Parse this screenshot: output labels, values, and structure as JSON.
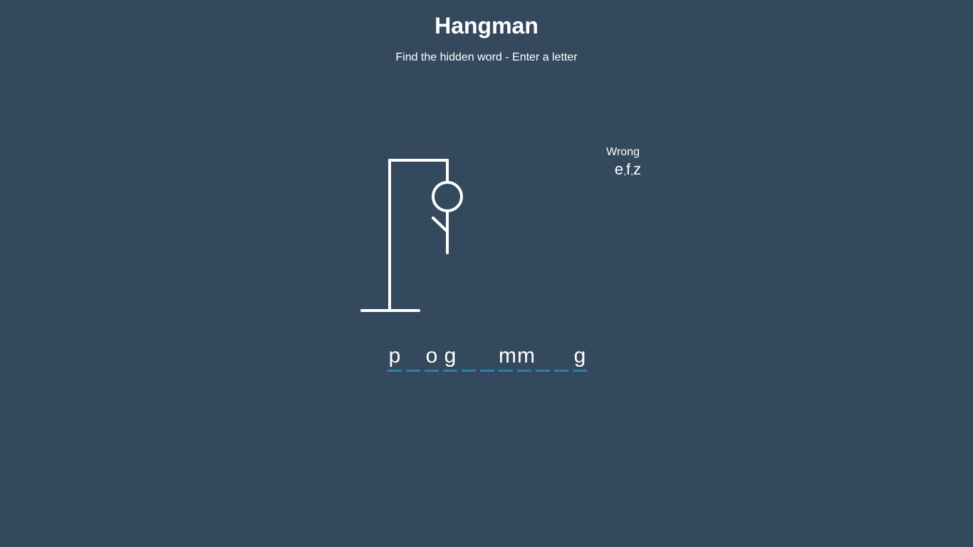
{
  "header": {
    "title": "Hangman",
    "subtitle": "Find the hidden word - Enter a letter"
  },
  "wrong": {
    "label": "Wrong",
    "letters": [
      "e",
      "f",
      "z"
    ]
  },
  "word": {
    "slots": [
      "p",
      "",
      "o",
      "g",
      "",
      "",
      "m",
      "m",
      "",
      "",
      "g"
    ]
  },
  "colors": {
    "background": "#34495e",
    "underline": "#2980b9",
    "text": "#ffffff"
  },
  "figure": {
    "parts_shown": [
      "head",
      "body",
      "left-arm"
    ]
  }
}
